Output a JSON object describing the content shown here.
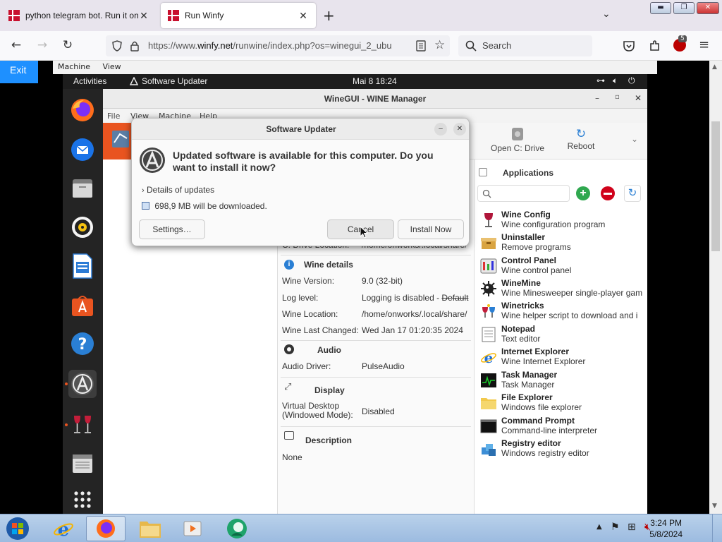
{
  "browser": {
    "tabs": [
      {
        "title": "python telegram bot. Run it onl",
        "active": false
      },
      {
        "title": "Run Winfy",
        "active": true
      }
    ],
    "url_prefix": "https://www.",
    "url_domain": "winfy.net",
    "url_rest": "/runwine/index.php?os=winegui_2_ubu",
    "search_placeholder": "Search",
    "extension_badge": "5"
  },
  "page": {
    "exit_label": "Exit",
    "vm_menu": [
      "Machine",
      "View"
    ]
  },
  "ubuntu": {
    "activities": "Activities",
    "app_indicator": "Software Updater",
    "datetime": "Mai 8  18:24"
  },
  "winegui": {
    "title": "WineGUI - WINE Manager",
    "menu": [
      "File",
      "View",
      "Machine",
      "Help"
    ],
    "toolbar": [
      {
        "label": "Open C: Drive",
        "icon": "drive-icon"
      },
      {
        "label": "Reboot",
        "icon": "reboot-icon"
      }
    ],
    "details": {
      "c_drive_label": "C: Drive Location:",
      "c_drive_value": "/home/onworks/.local/share/",
      "wine_section": "Wine details",
      "wine_version_label": "Wine Version:",
      "wine_version_value": "9.0 (32-bit)",
      "log_level_label": "Log level:",
      "log_level_value": "Logging is disabled - ",
      "log_level_default": "Default",
      "wine_location_label": "Wine Location:",
      "wine_location_value": "/home/onworks/.local/share/",
      "wine_changed_label": "Wine Last Changed:",
      "wine_changed_value": "Wed Jan 17 01:20:35 2024",
      "audio_section": "Audio",
      "audio_driver_label": "Audio Driver:",
      "audio_driver_value": "PulseAudio",
      "display_section": "Display",
      "virtual_desktop_label": "Virtual Desktop\n(Windowed Mode):",
      "virtual_desktop_value": "Disabled",
      "description_section": "Description",
      "description_value": "None"
    },
    "applications": {
      "title": "Applications",
      "items": [
        {
          "name": "Wine Config",
          "desc": "Wine configuration program",
          "icon": "wine-glass-icon"
        },
        {
          "name": "Uninstaller",
          "desc": "Remove programs",
          "icon": "box-icon"
        },
        {
          "name": "Control Panel",
          "desc": "Wine control panel",
          "icon": "control-panel-icon"
        },
        {
          "name": "WineMine",
          "desc": "Wine Minesweeper single-player gam",
          "icon": "mine-icon"
        },
        {
          "name": "Winetricks",
          "desc": "Wine helper script to download and i",
          "icon": "winetricks-icon"
        },
        {
          "name": "Notepad",
          "desc": "Text editor",
          "icon": "notepad-icon"
        },
        {
          "name": "Internet Explorer",
          "desc": "Wine Internet Explorer",
          "icon": "ie-icon"
        },
        {
          "name": "Task Manager",
          "desc": "Task Manager",
          "icon": "task-manager-icon"
        },
        {
          "name": "File Explorer",
          "desc": "Windows file explorer",
          "icon": "folder-icon"
        },
        {
          "name": "Command Prompt",
          "desc": "Command-line interpreter",
          "icon": "terminal-icon"
        },
        {
          "name": "Registry editor",
          "desc": "Windows registry editor",
          "icon": "registry-icon"
        }
      ]
    }
  },
  "dialog": {
    "title": "Software Updater",
    "message": "Updated software is available for this computer. Do you want to install it now?",
    "details_label": "Details of updates",
    "download_size": "698,9 MB will be downloaded.",
    "settings_button": "Settings…",
    "cancel_button": "Cancel",
    "install_button": "Install Now"
  },
  "taskbar": {
    "time": "3:24 PM",
    "date": "5/8/2024"
  },
  "colors": {
    "exit_button": "#1e90ff",
    "ubuntu_orange": "#e95420",
    "taskbar": "#b9d1ea"
  }
}
